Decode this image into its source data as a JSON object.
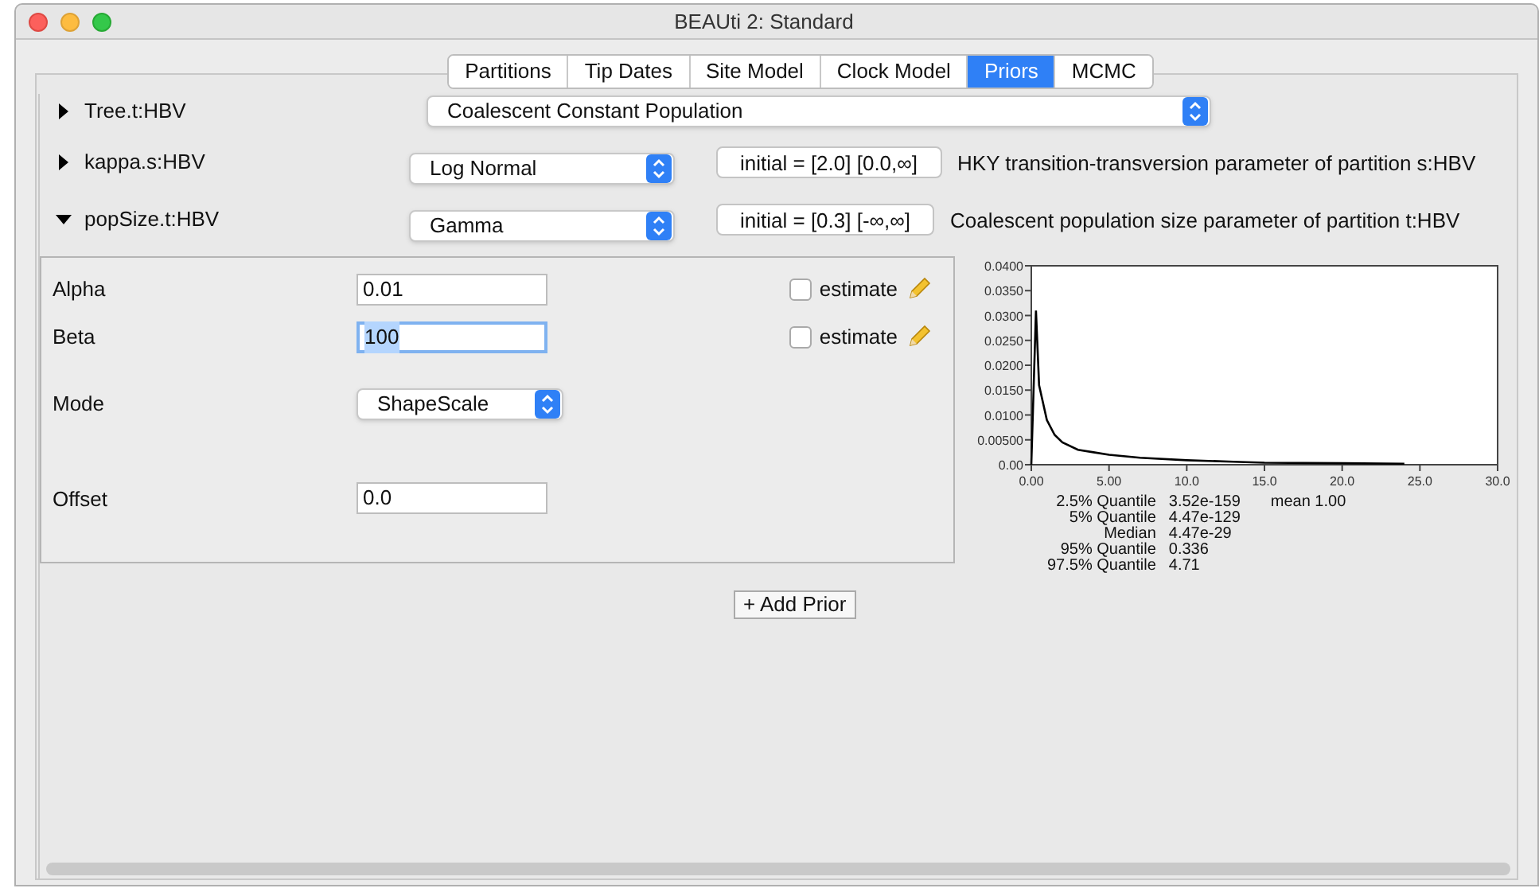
{
  "window": {
    "title": "BEAUti 2: Standard"
  },
  "tabs": [
    {
      "label": "Partitions",
      "selected": false
    },
    {
      "label": "Tip Dates",
      "selected": false
    },
    {
      "label": "Site Model",
      "selected": false
    },
    {
      "label": "Clock Model",
      "selected": false
    },
    {
      "label": "Priors",
      "selected": true
    },
    {
      "label": "MCMC",
      "selected": false
    }
  ],
  "priors": [
    {
      "name": "Tree.t:HBV",
      "expanded": false,
      "distribution": "Coalescent Constant Population"
    },
    {
      "name": "kappa.s:HBV",
      "expanded": false,
      "distribution": "Log Normal",
      "initial": "initial = [2.0] [0.0,∞]",
      "description": "HKY transition-transversion parameter of partition s:HBV"
    },
    {
      "name": "popSize.t:HBV",
      "expanded": true,
      "distribution": "Gamma",
      "initial": "initial = [0.3] [-∞,∞]",
      "description": "Coalescent population size parameter of partition t:HBV",
      "parameters": [
        {
          "kind": "field",
          "label": "Alpha",
          "value": "0.01",
          "focused": false,
          "estimate": {
            "label": "estimate",
            "checked": false
          }
        },
        {
          "kind": "field",
          "label": "Beta",
          "value": "100",
          "focused": true,
          "estimate": {
            "label": "estimate",
            "checked": false
          }
        },
        {
          "kind": "select",
          "label": "Mode",
          "value": "ShapeScale"
        },
        {
          "kind": "field",
          "label": "Offset",
          "value": "0.0",
          "focused": false
        }
      ],
      "chart_data": {
        "type": "line",
        "x": [
          0,
          0.3,
          0.5,
          1,
          1.5,
          2,
          3,
          4,
          5,
          7,
          10,
          13,
          15,
          20,
          24
        ],
        "series": [
          {
            "color": "#000000",
            "values": [
              0,
              0.031,
              0.016,
              0.009,
              0.006,
              0.0045,
              0.003,
              0.0025,
              0.002,
              0.0014,
              0.0009,
              0.0006,
              0.0004,
              0.0003,
              0.0002
            ]
          }
        ],
        "xlim": [
          0,
          30
        ],
        "ylim": [
          0,
          0.04
        ],
        "xticks": [
          {
            "value": 0,
            "label": "0.00"
          },
          {
            "value": 5,
            "label": "5.00"
          },
          {
            "value": 10,
            "label": "10.0"
          },
          {
            "value": 15,
            "label": "15.0"
          },
          {
            "value": 20,
            "label": "20.0"
          },
          {
            "value": 25,
            "label": "25.0"
          },
          {
            "value": 30,
            "label": "30.0"
          }
        ],
        "yticks": [
          {
            "value": 0,
            "label": "0.00"
          },
          {
            "value": 0.005,
            "label": "0.00500"
          },
          {
            "value": 0.01,
            "label": "0.0100"
          },
          {
            "value": 0.015,
            "label": "0.0150"
          },
          {
            "value": 0.02,
            "label": "0.0200"
          },
          {
            "value": 0.025,
            "label": "0.0250"
          },
          {
            "value": 0.03,
            "label": "0.0300"
          },
          {
            "value": 0.035,
            "label": "0.0350"
          },
          {
            "value": 0.04,
            "label": "0.0400"
          }
        ]
      },
      "quantiles": [
        {
          "label": "2.5% Quantile",
          "value": "3.52e-159"
        },
        {
          "label": "5% Quantile",
          "value": "4.47e-129"
        },
        {
          "label": "Median",
          "value": "4.47e-29"
        },
        {
          "label": "95% Quantile",
          "value": "0.336"
        },
        {
          "label": "97.5% Quantile",
          "value": "4.71"
        }
      ],
      "mean": "mean 1.00"
    }
  ],
  "add_button": "+ Add Prior"
}
